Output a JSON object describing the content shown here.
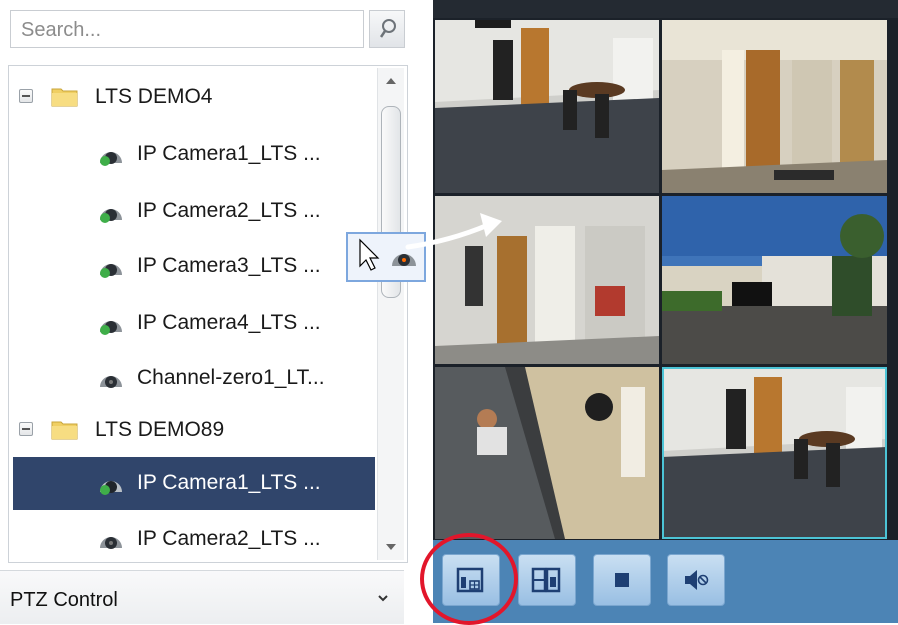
{
  "search": {
    "placeholder": "Search...",
    "icon": "search-icon"
  },
  "tree": {
    "items": [
      {
        "type": "group",
        "label": "LTS DEMO4",
        "expanded": true,
        "icon": "folder-icon"
      },
      {
        "type": "camera",
        "label": "IP Camera1_LTS ...",
        "icon": "camera-online-icon"
      },
      {
        "type": "camera",
        "label": "IP Camera2_LTS ...",
        "icon": "camera-online-icon"
      },
      {
        "type": "camera",
        "label": "IP Camera3_LTS ...",
        "icon": "camera-online-icon"
      },
      {
        "type": "camera",
        "label": "IP Camera4_LTS ...",
        "icon": "camera-online-icon"
      },
      {
        "type": "camera",
        "label": "Channel-zero1_LT...",
        "icon": "camera-icon"
      },
      {
        "type": "group",
        "label": "LTS DEMO89",
        "expanded": true,
        "icon": "folder-icon"
      },
      {
        "type": "camera",
        "label": "IP Camera1_LTS ...",
        "icon": "camera-online-icon",
        "selected": true
      },
      {
        "type": "camera",
        "label": "IP Camera2_LTS ...",
        "icon": "camera-icon"
      }
    ]
  },
  "ptz": {
    "label": "PTZ Control",
    "icon": "chevron-down-icon"
  },
  "toolbar": {
    "buttons": [
      {
        "name": "window-division-button",
        "icon": "window-layout-icon"
      },
      {
        "name": "custom-layout-button",
        "icon": "custom-layout-icon"
      },
      {
        "name": "stop-all-button",
        "icon": "stop-icon"
      },
      {
        "name": "mute-button",
        "icon": "mute-icon"
      }
    ]
  },
  "colors": {
    "selection": "#30456b",
    "toolbar": "#4c84b5",
    "highlight_circle": "#e2162b",
    "active_tile": "#4cc4d6"
  }
}
